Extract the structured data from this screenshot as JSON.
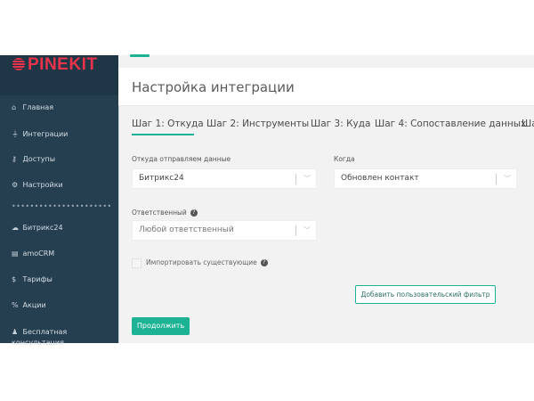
{
  "brand": {
    "logo_text": "PINEKIT",
    "accent": "#1bb394",
    "logo_color": "#e8334a"
  },
  "sidebar": {
    "items": [
      {
        "label": "Главная",
        "icon": "home-icon"
      },
      {
        "label": "Интеграции",
        "icon": "plug-icon"
      },
      {
        "label": "Доступы",
        "icon": "key-icon"
      },
      {
        "label": "Настройки",
        "icon": "gears-icon"
      },
      {
        "label": "Битрикс24",
        "icon": "cloud-icon"
      },
      {
        "label": "amoCRM",
        "icon": "card-icon"
      },
      {
        "label": "Тарифы",
        "icon": "dollar-icon"
      },
      {
        "label": "Акции",
        "icon": "percent-icon"
      },
      {
        "label": "Бесплатная консультация",
        "icon": "user-icon"
      }
    ],
    "separator": "••••••••••••••••••••••"
  },
  "header": {
    "title": "Настройка интеграции"
  },
  "tabs": [
    "Шаг 1: Откуда",
    "Шаг 2: Инструменты",
    "Шаг 3: Куда",
    "Шаг 4: Сопоставление данных",
    "Шаг"
  ],
  "form": {
    "source_label": "Откуда отправляем данные",
    "source_value": "Битрикс24",
    "when_label": "Когда",
    "when_value": "Обновлен контакт",
    "owner_label": "Ответственный",
    "owner_value": "Любой ответственный",
    "import_label": "Импортировать существующие",
    "import_checked": false,
    "filter_button": "Добавить пользовательский фильтр",
    "continue_button": "Продолжить"
  }
}
